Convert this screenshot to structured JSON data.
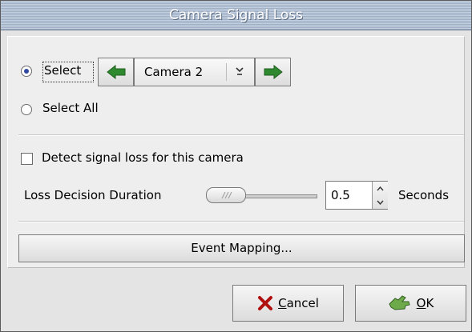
{
  "window": {
    "title": "Camera Signal Loss"
  },
  "selection": {
    "select_label": "Select",
    "select_all_label": "Select All",
    "camera_value": "Camera 2",
    "select_checked": true
  },
  "detection": {
    "detect_label": "Detect signal loss for this camera",
    "detect_checked": false,
    "duration_label": "Loss Decision Duration",
    "duration_value": "0.5",
    "duration_units": "Seconds"
  },
  "event_mapping": {
    "label": "Event Mapping..."
  },
  "buttons": {
    "cancel_mnemonic": "C",
    "cancel_rest": "ancel",
    "ok_mnemonic": "O",
    "ok_rest": "K"
  },
  "colors": {
    "radio_dot": "#2f49a3",
    "prev_arrow": "#2f8a2f",
    "next_arrow": "#2f8a2f",
    "cancel_icon": "#b01010"
  },
  "icons": {
    "prev": "left-arrow-icon",
    "next": "right-arrow-icon",
    "dropdown": "chevron-down-icon",
    "spin_up": "chevron-up-icon",
    "spin_down": "chevron-down-icon",
    "cancel": "cancel-x-icon",
    "ok": "ok-hand-icon"
  }
}
